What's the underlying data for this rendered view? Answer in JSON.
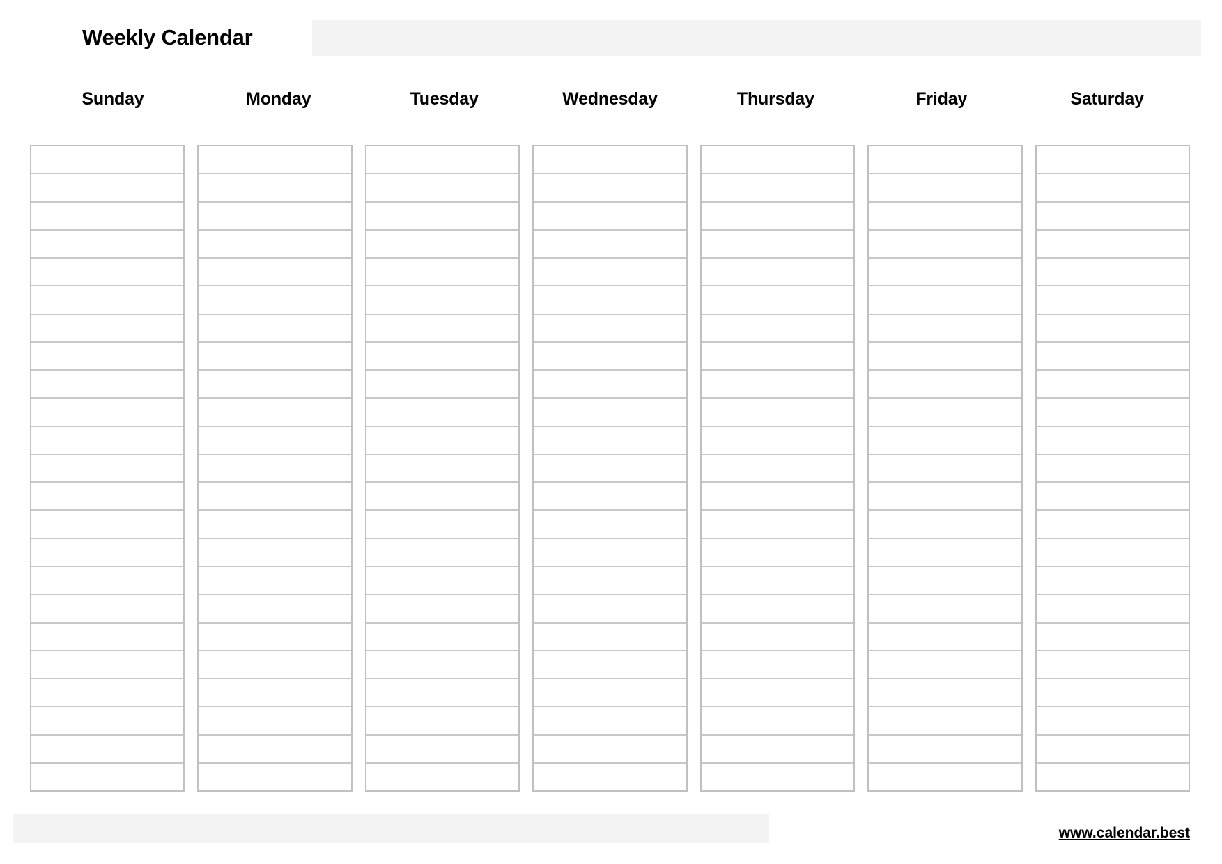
{
  "header": {
    "title": "Weekly Calendar",
    "bar_color": "#f3f3f3"
  },
  "calendar": {
    "day_headers": [
      "Sunday",
      "Monday",
      "Tuesday",
      "Wednesday",
      "Thursday",
      "Friday",
      "Saturday"
    ],
    "rows_per_day": 23,
    "cell_text": "",
    "border_color": "#c0c0c0",
    "grid_line_color": "#c7c7c7"
  },
  "footer": {
    "bar_color": "#f3f3f3",
    "link_text": "www.calendar.best"
  }
}
